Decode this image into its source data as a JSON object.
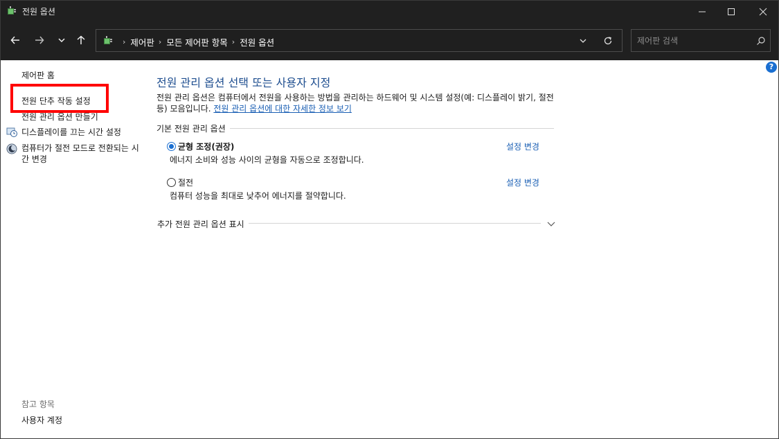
{
  "window": {
    "title": "전원 옵션"
  },
  "address_bar": {
    "crumbs": [
      "제어판",
      "모든 제어판 항목",
      "전원 옵션"
    ]
  },
  "search": {
    "placeholder": "제어판 검색"
  },
  "left_pane": {
    "home": "제어판 홈",
    "items": [
      "전원 단추 작동 설정",
      "전원 관리 옵션 만들기",
      "디스플레이를 끄는 시간 설정",
      "컴퓨터가 절전 모드로 전환되는 시간 변경"
    ],
    "see_also_title": "참고 항목",
    "see_also_items": [
      "사용자 계정"
    ]
  },
  "main": {
    "title": "전원 관리 옵션 선택 또는 사용자 지정",
    "description": "전원 관리 옵션은 컴퓨터에서 전원을 사용하는 방법을 관리하는 하드웨어 및 시스템 설정(예: 디스플레이 밝기, 절전 등) 모음입니다. ",
    "description_link": "전원 관리 옵션에 대한 자세한 정보 보기",
    "group_title": "기본 전원 관리 옵션",
    "plans": [
      {
        "name": "균형 조정(권장)",
        "description": "에너지 소비와 성능 사이의 균형을 자동으로 조정합니다.",
        "selected": true,
        "change_label": "설정 변경"
      },
      {
        "name": "절전",
        "description": "컴퓨터 성능을 최대로 낮추어 에너지를 절약합니다.",
        "selected": false,
        "change_label": "설정 변경"
      }
    ],
    "more_label": "추가 전원 관리 옵션 표시"
  },
  "help_label": "?",
  "colors": {
    "accent": "#1a6fd1",
    "link": "#1a5fb4",
    "title": "#1d4d8f",
    "highlight": "#ff0000"
  }
}
